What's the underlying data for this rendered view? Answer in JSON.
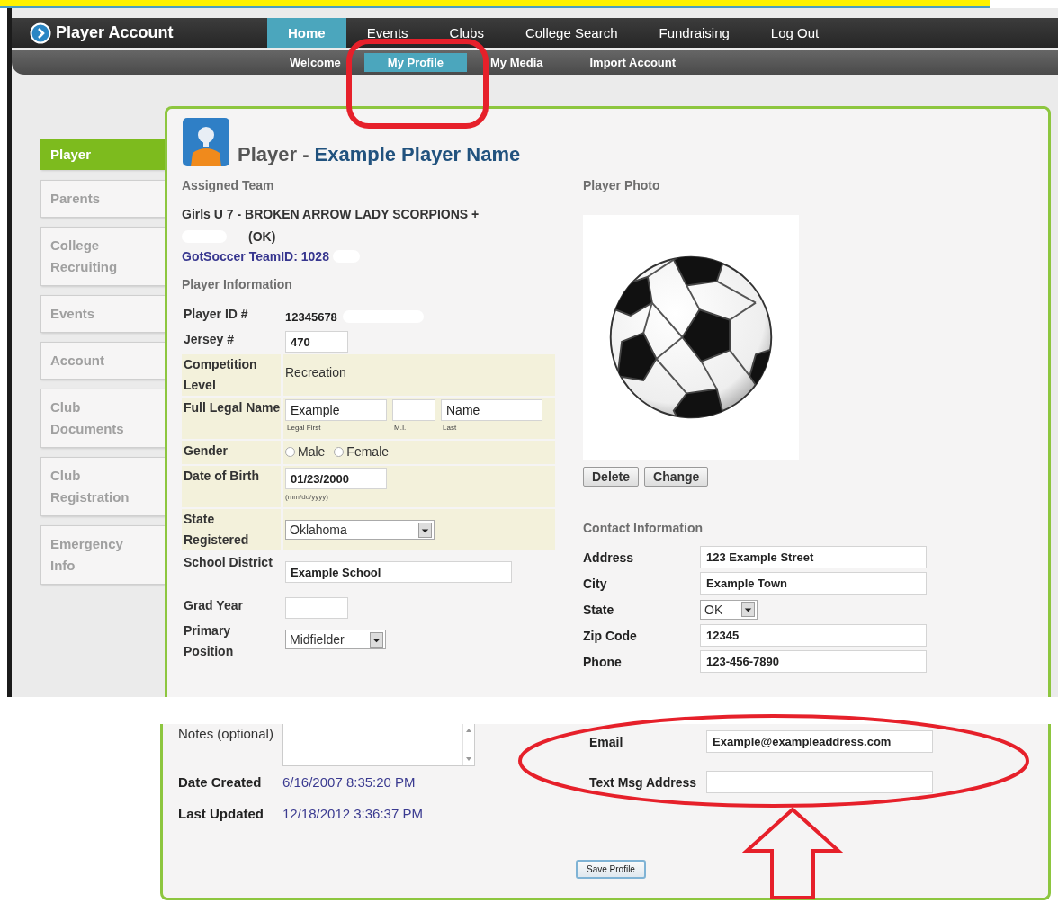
{
  "nav": {
    "brand": "Player Account",
    "tabs": [
      {
        "label": "Home",
        "selected": true
      },
      {
        "label": "Events",
        "selected": false
      },
      {
        "label": "Clubs",
        "selected": false
      },
      {
        "label": "College Search",
        "selected": false
      },
      {
        "label": "Fundraising",
        "selected": false
      },
      {
        "label": "Log Out",
        "selected": false
      }
    ]
  },
  "subnav": {
    "tabs": [
      {
        "label": "Welcome",
        "selected": false
      },
      {
        "label": "My Profile",
        "selected": true
      },
      {
        "label": "My Media",
        "selected": false
      },
      {
        "label": "Import Account",
        "selected": false
      }
    ]
  },
  "sidebar": {
    "items": [
      {
        "label": "Player",
        "selected": true
      },
      {
        "label": "Parents",
        "selected": false
      },
      {
        "label": "College Recruiting",
        "selected": false
      },
      {
        "label": "Events",
        "selected": false
      },
      {
        "label": "Account",
        "selected": false
      },
      {
        "label": "Club Documents",
        "selected": false
      },
      {
        "label": "Club Registration",
        "selected": false
      },
      {
        "label": "Emergency Info",
        "selected": false
      }
    ]
  },
  "header": {
    "title": "Player -",
    "player_name": "Example Player Name"
  },
  "assigned_team": {
    "heading": "Assigned Team",
    "team": "Girls U 7  - BROKEN ARROW LADY SCORPIONS +",
    "status": "(OK)",
    "team_id": "GotSoccer TeamID: 1028"
  },
  "player_info": {
    "heading": "Player Information",
    "rows": [
      {
        "kind": "text",
        "label": "Player ID #",
        "value": "12345678",
        "shaded": false
      },
      {
        "kind": "short_input",
        "label": "Jersey #",
        "value": "470",
        "shaded": false
      },
      {
        "kind": "plain",
        "label": "Competition Level",
        "value": "Recreation",
        "shaded": true
      },
      {
        "kind": "name",
        "label": "Full Legal Name",
        "shaded": true,
        "parts": [
          {
            "value": "Example",
            "caption": "Legal First"
          },
          {
            "caption": "M.I."
          },
          {
            "value": "Name",
            "caption": "Last"
          }
        ]
      },
      {
        "kind": "radio",
        "label": "Gender",
        "shaded": true,
        "options": [
          {
            "label": "Male",
            "selected": false
          },
          {
            "label": "Female",
            "selected": false
          }
        ]
      },
      {
        "kind": "date",
        "label": "Date of Birth",
        "value": "01/23/2000",
        "hint": "(mm/dd/yyyy)",
        "shaded": true
      },
      {
        "kind": "select",
        "label": "State Registered",
        "value": "Oklahoma",
        "shaded": true
      },
      {
        "kind": "long_input",
        "label": "School District",
        "value": "Example School",
        "shaded": false
      },
      {
        "kind": "short_input",
        "label": "Grad Year",
        "shaded": false
      },
      {
        "kind": "short_select",
        "label": "Primary Position",
        "value": "Midfielder",
        "shaded": false
      }
    ]
  },
  "player_photo": {
    "heading": "Player Photo",
    "buttons": [
      "Delete",
      "Change"
    ]
  },
  "contact": {
    "heading": "Contact Information",
    "rows": [
      {
        "kind": "input",
        "label": "Address",
        "value": "123 Example Street"
      },
      {
        "kind": "input",
        "label": "City",
        "value": "Example Town"
      },
      {
        "kind": "select",
        "label": "State",
        "value": "OK"
      },
      {
        "kind": "input",
        "label": "Zip Code",
        "value": "12345"
      },
      {
        "kind": "input",
        "label": "Phone",
        "value": "123-456-7890"
      }
    ]
  },
  "lower_section": {
    "notes_label": "Notes (optional)",
    "dates": [
      {
        "label": "Date Created",
        "value": "6/16/2007 8:35:20 PM"
      },
      {
        "label": "Last Updated",
        "value": "12/18/2012 3:36:37 PM"
      }
    ],
    "contact_rows": [
      {
        "kind": "input",
        "label": "Email",
        "value": "Example@exampleaddress.com"
      },
      {
        "kind": "input",
        "label": "Text Msg Address"
      }
    ],
    "save_button": "Save Profile"
  }
}
